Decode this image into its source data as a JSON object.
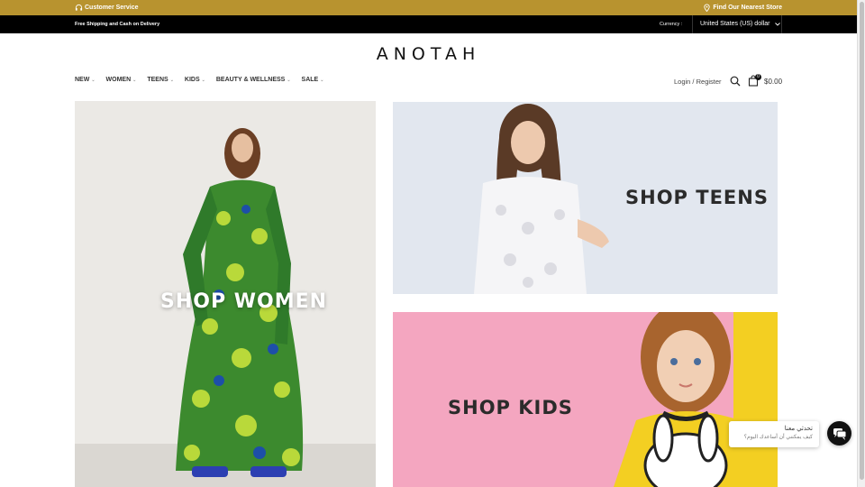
{
  "topbar": {
    "customer_service": "Customer Service",
    "find_store": "Find Our Nearest Store"
  },
  "infobar": {
    "shipping": "Free Shipping and Cash on Delivery",
    "currency_label": "Currency :",
    "currency_value": "United States (US) dollar"
  },
  "header": {
    "logo": "ANOTAH",
    "nav": [
      "NEW",
      "WOMEN",
      "TEENS",
      "KIDS",
      "BEAUTY & WELLNESS",
      "SALE"
    ],
    "account": "Login / Register",
    "cart_count": "0",
    "cart_total": "$0.00"
  },
  "tiles": {
    "women": "SHOP WOMEN",
    "teens": "SHOP TEENS",
    "kids": "SHOP KIDS"
  },
  "chat": {
    "title": "تحدثي معنا",
    "subtitle": "كيف يمكنني أن أساعدك اليوم؟"
  },
  "colors": {
    "topbar": "#b8932f",
    "infobar": "#000000",
    "kids_bg": "#f4a6c0",
    "kids_accent": "#f3cf22"
  },
  "icons": {
    "customer_service": "headset-icon",
    "store": "location-pin-icon",
    "search": "search-icon",
    "cart": "shopping-bag-icon",
    "chat": "chat-icon"
  }
}
